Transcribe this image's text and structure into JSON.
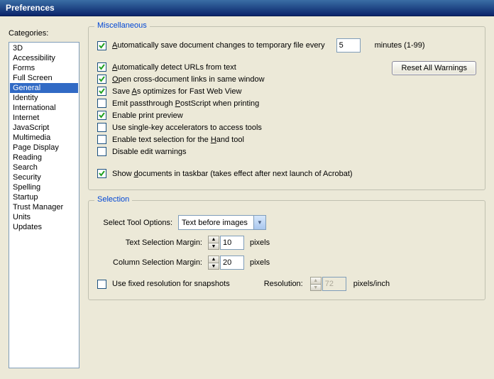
{
  "window": {
    "title": "Preferences"
  },
  "sidebar": {
    "label": "Categories:",
    "items": [
      {
        "label": "3D"
      },
      {
        "label": "Accessibility"
      },
      {
        "label": "Forms"
      },
      {
        "label": "Full Screen"
      },
      {
        "label": "General",
        "selected": true
      },
      {
        "label": "Identity"
      },
      {
        "label": "International"
      },
      {
        "label": "Internet"
      },
      {
        "label": "JavaScript"
      },
      {
        "label": "Multimedia"
      },
      {
        "label": "Page Display"
      },
      {
        "label": "Reading"
      },
      {
        "label": "Search"
      },
      {
        "label": "Security"
      },
      {
        "label": "Spelling"
      },
      {
        "label": "Startup"
      },
      {
        "label": "Trust Manager"
      },
      {
        "label": "Units"
      },
      {
        "label": "Updates"
      }
    ]
  },
  "misc": {
    "title": "Miscellaneous",
    "autosave": {
      "label_pre": "Automatically save document changes to temporary file every",
      "value": "5",
      "label_post": "minutes (1-99)",
      "checked": true
    },
    "reset_button": "Reset All Warnings",
    "options": [
      {
        "label": "Automatically detect URLs from text",
        "checked": true,
        "u": 0
      },
      {
        "label": "Open cross-document links in same window",
        "checked": true,
        "u": 0
      },
      {
        "label": "Save As optimizes for Fast Web View",
        "checked": true,
        "u": 5
      },
      {
        "label": "Emit passthrough PostScript when printing",
        "checked": false,
        "u": 17
      },
      {
        "label": "Enable print preview",
        "checked": true,
        "u": -1
      },
      {
        "label": "Use single-key accelerators to access tools",
        "checked": false,
        "u": -1
      },
      {
        "label": "Enable text selection for the Hand tool",
        "checked": false,
        "u": 30
      },
      {
        "label": "Disable edit warnings",
        "checked": false,
        "u": -1
      }
    ],
    "taskbar": {
      "label": "Show documents in taskbar (takes effect after next launch of Acrobat)",
      "checked": true,
      "u": 5
    }
  },
  "selection": {
    "title": "Selection",
    "tool_options_label": "Select Tool Options:",
    "tool_options_value": "Text before images",
    "text_margin_label": "Text Selection Margin:",
    "text_margin_value": "10",
    "column_margin_label": "Column Selection Margin:",
    "column_margin_value": "20",
    "pixels": "pixels",
    "fixed_res": {
      "label": "Use fixed resolution for snapshots",
      "checked": false
    },
    "resolution_label": "Resolution:",
    "resolution_value": "72",
    "resolution_unit": "pixels/inch"
  }
}
